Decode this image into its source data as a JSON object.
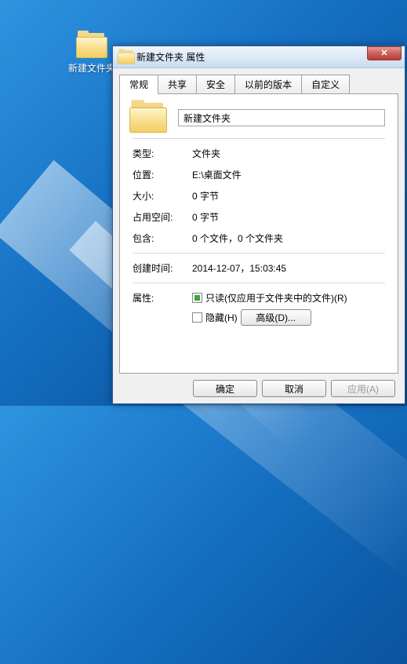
{
  "desktop": {
    "icon_label": "新建文件夹"
  },
  "dialog": {
    "title": "新建文件夹 属性",
    "tabs": [
      "常规",
      "共享",
      "安全",
      "以前的版本",
      "自定义"
    ],
    "active_tab": 0,
    "folder_name": "新建文件夹",
    "rows": {
      "type_label": "类型:",
      "type_value": "文件夹",
      "location_label": "位置:",
      "location_value": "E:\\桌面文件",
      "size_label": "大小:",
      "size_value": "0 字节",
      "disk_label": "占用空间:",
      "disk_value": "0 字节",
      "contains_label": "包含:",
      "contains_value": "0 个文件，0 个文件夹",
      "created_label": "创建时间:",
      "created_value": "2014-12-07，15:03:45",
      "attributes_label": "属性:",
      "readonly_label": "只读(仅应用于文件夹中的文件)(R)",
      "hidden_label": "隐藏(H)",
      "advanced_label": "高级(D)..."
    },
    "buttons": {
      "ok": "确定",
      "cancel": "取消",
      "apply": "应用(A)"
    }
  }
}
